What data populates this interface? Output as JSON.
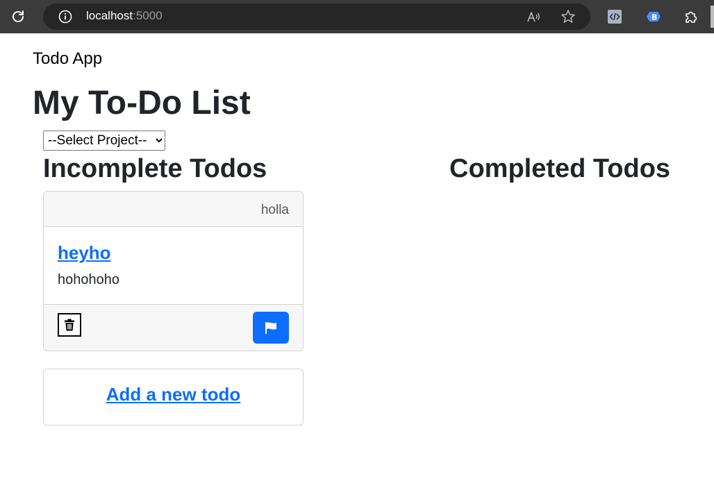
{
  "browser": {
    "url_host": "localhost",
    "url_port": ":5000"
  },
  "navbar": {
    "brand": "Todo App"
  },
  "page": {
    "title": "My To-Do List"
  },
  "project_select": {
    "selected": "--Select Project--"
  },
  "incomplete": {
    "heading": "Incomplete Todos",
    "todos": [
      {
        "project": "holla",
        "title": "heyho",
        "description": "hohohoho"
      }
    ],
    "add_link": "Add a new todo"
  },
  "completed": {
    "heading": "Completed Todos"
  },
  "colors": {
    "primary": "#0d6efd",
    "chrome_bg": "#3b3b3b",
    "urlbar_bg": "#262626"
  }
}
